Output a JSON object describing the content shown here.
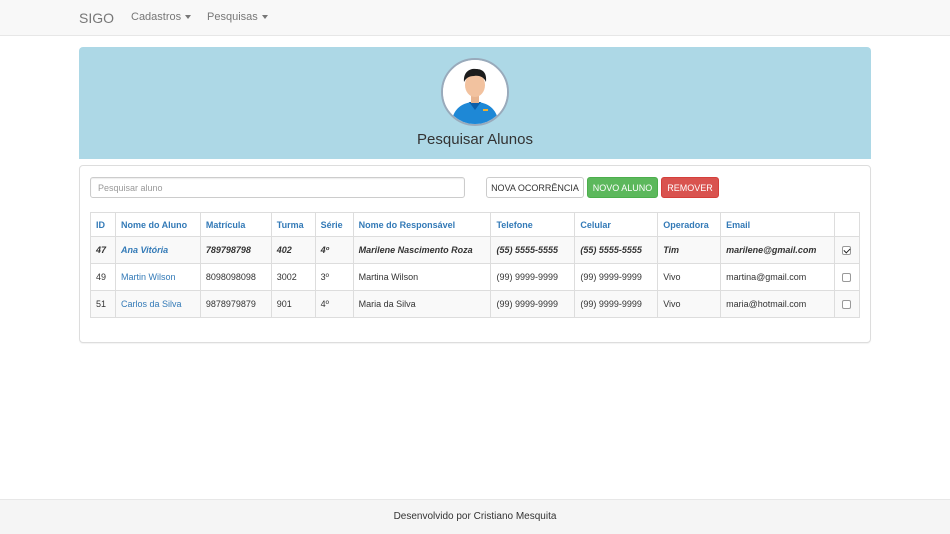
{
  "navbar": {
    "brand": "SIGO",
    "menus": [
      {
        "label": "Cadastros"
      },
      {
        "label": "Pesquisas"
      }
    ]
  },
  "jumbotron": {
    "title": "Pesquisar Alunos"
  },
  "search": {
    "placeholder": "Pesquisar aluno",
    "value": ""
  },
  "actions": {
    "nova_ocorrencia": "NOVA OCORRÊNCIA",
    "novo_aluno": "NOVO ALUNO",
    "remover": "REMOVER"
  },
  "table": {
    "headers": [
      "ID",
      "Nome do Aluno",
      "Matrícula",
      "Turma",
      "Série",
      "Nome do Responsável",
      "Telefone",
      "Celular",
      "Operadora",
      "Email",
      ""
    ],
    "rows": [
      {
        "id": "47",
        "nome": "Ana Vitória",
        "matricula": "789798798",
        "turma": "402",
        "serie": "4º",
        "responsavel": "Marilene Nascimento Roza",
        "telefone": "(55) 5555-5555",
        "celular": "(55) 5555-5555",
        "operadora": "Tim",
        "email": "marilene@gmail.com",
        "checked": true
      },
      {
        "id": "49",
        "nome": "Martin Wilson",
        "matricula": "8098098098",
        "turma": "3002",
        "serie": "3º",
        "responsavel": "Martina Wilson",
        "telefone": "(99) 9999-9999",
        "celular": "(99) 9999-9999",
        "operadora": "Vivo",
        "email": "martina@gmail.com",
        "checked": false
      },
      {
        "id": "51",
        "nome": "Carlos da Silva",
        "matricula": "9878979879",
        "turma": "901",
        "serie": "4º",
        "responsavel": "Maria da Silva",
        "telefone": "(99) 9999-9999",
        "celular": "(99) 9999-9999",
        "operadora": "Vivo",
        "email": "maria@hotmail.com",
        "checked": false
      }
    ]
  },
  "footer": {
    "text": "Desenvolvido por Cristiano Mesquita"
  },
  "colors": {
    "jumbotron_bg": "#add8e6",
    "link": "#337ab7",
    "success": "#5cb85c",
    "danger": "#d9534f"
  },
  "icons": {
    "avatar": "user-avatar-icon",
    "dropdown": "caret-down-icon",
    "checkbox": "checkbox-icon"
  }
}
